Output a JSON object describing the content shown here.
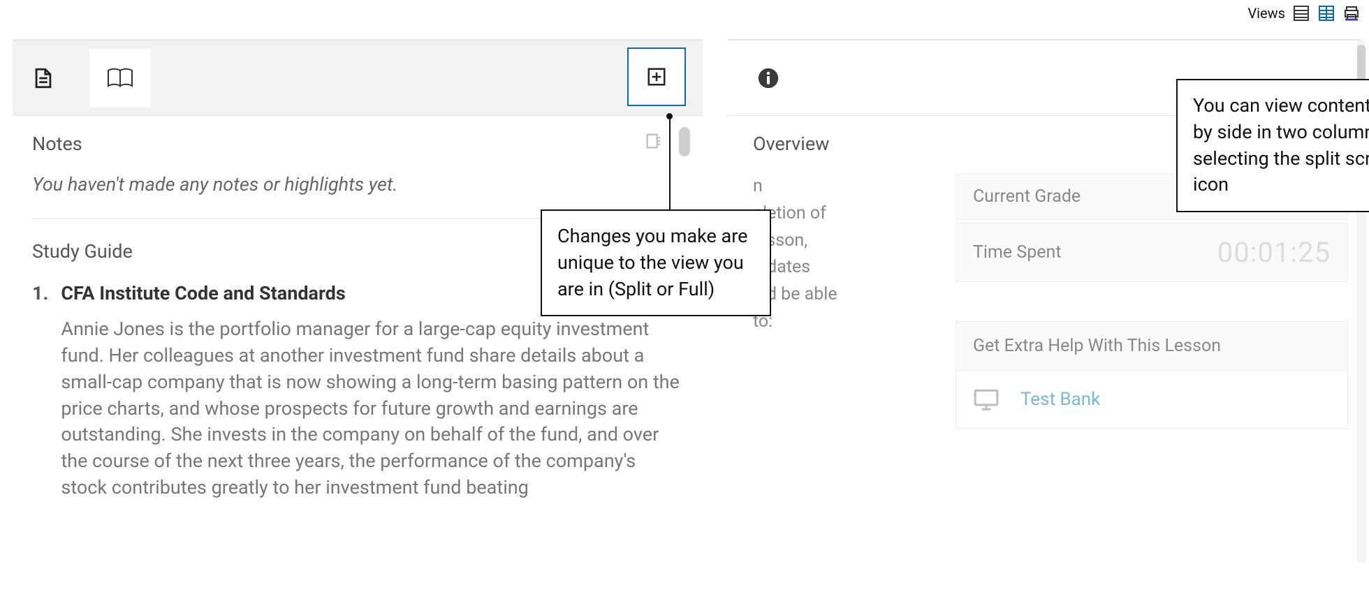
{
  "views": {
    "label": "Views",
    "full_icon": "full-view-icon",
    "split_icon": "split-view-icon",
    "print_icon": "print-icon"
  },
  "left": {
    "doc_icon": "document-icon",
    "book_icon": "book-icon",
    "add_icon": "add-panel-icon",
    "notes_heading": "Notes",
    "notes_empty": "You haven't made any notes or highlights yet.",
    "study_guide_heading": "Study Guide",
    "sg_items": [
      {
        "num": "1.",
        "title": "CFA Institute Code and Standards",
        "body": "Annie Jones is the portfolio manager for a large-cap equity investment fund. Her colleagues at another investment fund share details about a small-cap company that is now showing a long-term basing pattern on the price charts, and whose prospects for future growth and earnings are outstanding. She invests in the company on behalf of the fund, and over the course of the next three years, the performance of the company's stock contributes greatly to her investment fund beating"
      }
    ]
  },
  "right": {
    "info_icon": "info-icon",
    "overview_heading": "Overview",
    "overview_text_lines": [
      "n",
      "pletion of",
      "lesson,",
      "didates",
      "uld be able",
      "to:"
    ],
    "rows": [
      {
        "label": "Current Grade",
        "value": ""
      },
      {
        "label": "Time Spent",
        "value": "00:01:25"
      }
    ],
    "help_label": "Get Extra Help With This Lesson",
    "help_link": "Test Bank"
  },
  "callouts": {
    "c1": "Changes you make are unique to the view you are in (Split or Full)",
    "c2": "You can view content side by side in two columns by selecting the split screen icon"
  }
}
